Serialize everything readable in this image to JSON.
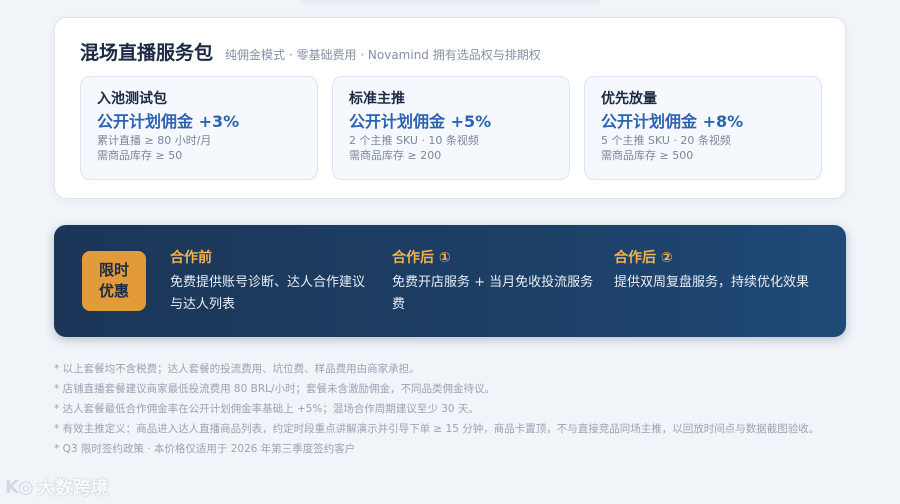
{
  "package": {
    "title": "混场直播服务包",
    "subtitle": "纯佣金模式 · 零基础费用 · Novamind 拥有选品权与排期权",
    "tiers": [
      {
        "name": "入池测试包",
        "rate": "公开计划佣金 +3%",
        "line1": "累计直播 ≥ 80 小时/月",
        "line2": "需商品库存 ≥ 50"
      },
      {
        "name": "标准主推",
        "rate": "公开计划佣金 +5%",
        "line1": "2 个主推 SKU · 10 条视频",
        "line2": "需商品库存 ≥ 200"
      },
      {
        "name": "优先放量",
        "rate": "公开计划佣金 +8%",
        "line1": "5 个主推 SKU · 20 条视频",
        "line2": "需商品库存 ≥ 500"
      }
    ]
  },
  "promo": {
    "badge_line1": "限时",
    "badge_line2": "优惠",
    "columns": [
      {
        "head": "合作前",
        "text": "免费提供账号诊断、达人合作建议与达人列表"
      },
      {
        "head": "合作后 ①",
        "text": "免费开店服务 + 当月免收投流服务费"
      },
      {
        "head": "合作后 ②",
        "text": "提供双周复盘服务，持续优化效果"
      }
    ]
  },
  "notes": [
    "* 以上套餐均不含税费；达人套餐的投流费用、坑位费、样品费用由商家承担。",
    "* 店铺直播套餐建议商家最低投流费用 80 BRL/小时；套餐未含激励佣金，不同品类佣金待议。",
    "* 达人套餐最低合作佣金率在公开计划佣金率基础上 +5%；混场合作周期建议至少 30 天。",
    "* 有效主推定义：商品进入达人直播商品列表，约定时段重点讲解演示并引导下单 ≥ 15 分钟，商品卡置顶，不与直接竞品同场主推，以回放时间点与数据截图验收。",
    "* Q3 限时签约政策 · 本价格仅适用于 2026 年第三季度签约客户"
  ],
  "watermark": {
    "logo": "K◎",
    "text": "大数跨境"
  }
}
